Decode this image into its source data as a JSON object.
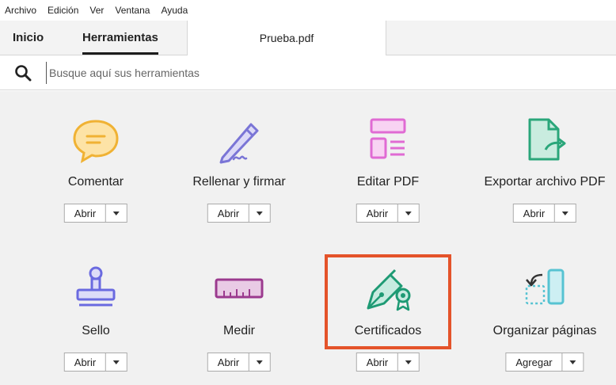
{
  "menubar": {
    "items": [
      "Archivo",
      "Edición",
      "Ver",
      "Ventana",
      "Ayuda"
    ]
  },
  "tabs": {
    "inicio": "Inicio",
    "herramientas": "Herramientas",
    "document": "Prueba.pdf"
  },
  "search": {
    "placeholder": "Busque aquí sus herramientas"
  },
  "tools": [
    {
      "name": "Comentar",
      "button": "Abrir",
      "icon": "comment-icon"
    },
    {
      "name": "Rellenar y firmar",
      "button": "Abrir",
      "icon": "fill-sign-icon"
    },
    {
      "name": "Editar PDF",
      "button": "Abrir",
      "icon": "edit-pdf-icon"
    },
    {
      "name": "Exportar archivo PDF",
      "button": "Abrir",
      "icon": "export-pdf-icon"
    },
    {
      "name": "Sello",
      "button": "Abrir",
      "icon": "stamp-icon"
    },
    {
      "name": "Medir",
      "button": "Abrir",
      "icon": "ruler-icon"
    },
    {
      "name": "Certificados",
      "button": "Abrir",
      "icon": "certificate-icon"
    },
    {
      "name": "Organizar páginas",
      "button": "Agregar",
      "icon": "organize-pages-icon"
    }
  ],
  "colors": {
    "highlight": "#e4532a",
    "comment": "#f0b234",
    "fill_sign": "#7a75d6",
    "edit_pdf": "#e06bd3",
    "export_pdf": "#2aa67a",
    "stamp": "#6a6ae0",
    "ruler": "#9b3a8e",
    "certificate": "#1e9a74",
    "organize": "#57c3d2"
  }
}
